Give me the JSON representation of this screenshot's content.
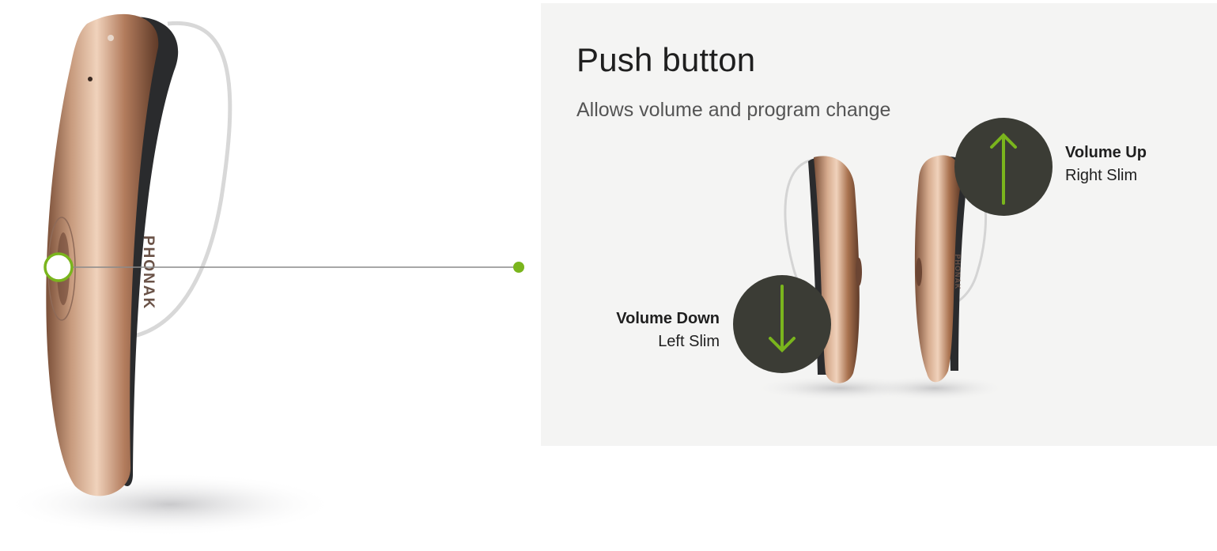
{
  "panel": {
    "title": "Push button",
    "subtitle": "Allows volume and program change"
  },
  "brand": {
    "large_logo": "PHONAK",
    "small_logo": "PHONAK"
  },
  "callouts": {
    "volume_down": {
      "title": "Volume Down",
      "subtitle": "Left Slim",
      "icon": "arrow-down-icon"
    },
    "volume_up": {
      "title": "Volume Up",
      "subtitle": "Right Slim",
      "icon": "arrow-up-icon"
    }
  },
  "colors": {
    "accent_green": "#7ab51d",
    "badge_dark": "#3b3c35",
    "panel_bg": "#f4f4f3",
    "bronze": "#b8866a",
    "dark_body": "#2a2b2d"
  }
}
